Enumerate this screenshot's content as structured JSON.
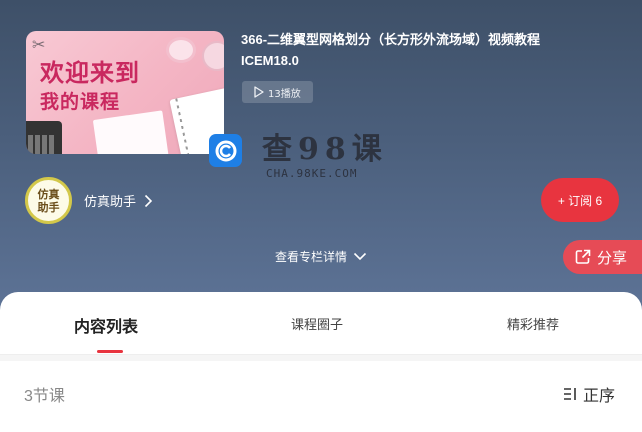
{
  "course": {
    "cover_line1": "欢迎来到",
    "cover_line2": "我的课程",
    "title": "366-二维翼型网格划分（长方形外流场域）视频教程ICEM18.0",
    "plays": "13播放"
  },
  "watermark": {
    "text": "查98课",
    "url": "CHA.98KE.COM"
  },
  "author": {
    "avatar_text": "仿真助手",
    "name": "仿真助手"
  },
  "actions": {
    "subscribe": "+ 订阅 6",
    "details": "查看专栏详情",
    "share": "分享"
  },
  "tabs": [
    {
      "label": "内容列表",
      "active": true
    },
    {
      "label": "课程圈子",
      "active": false
    },
    {
      "label": "精彩推荐",
      "active": false
    }
  ],
  "list": {
    "count": "3节课",
    "sort": "正序"
  },
  "colors": {
    "accent": "#e8343f",
    "header_top": "#3e5068",
    "header_bottom": "#5d7396"
  },
  "icons": {
    "play": "play-icon",
    "chevron_right": "chevron-right-icon",
    "chevron_down": "chevron-down-icon",
    "share": "share-icon",
    "sort": "sort-icon"
  }
}
